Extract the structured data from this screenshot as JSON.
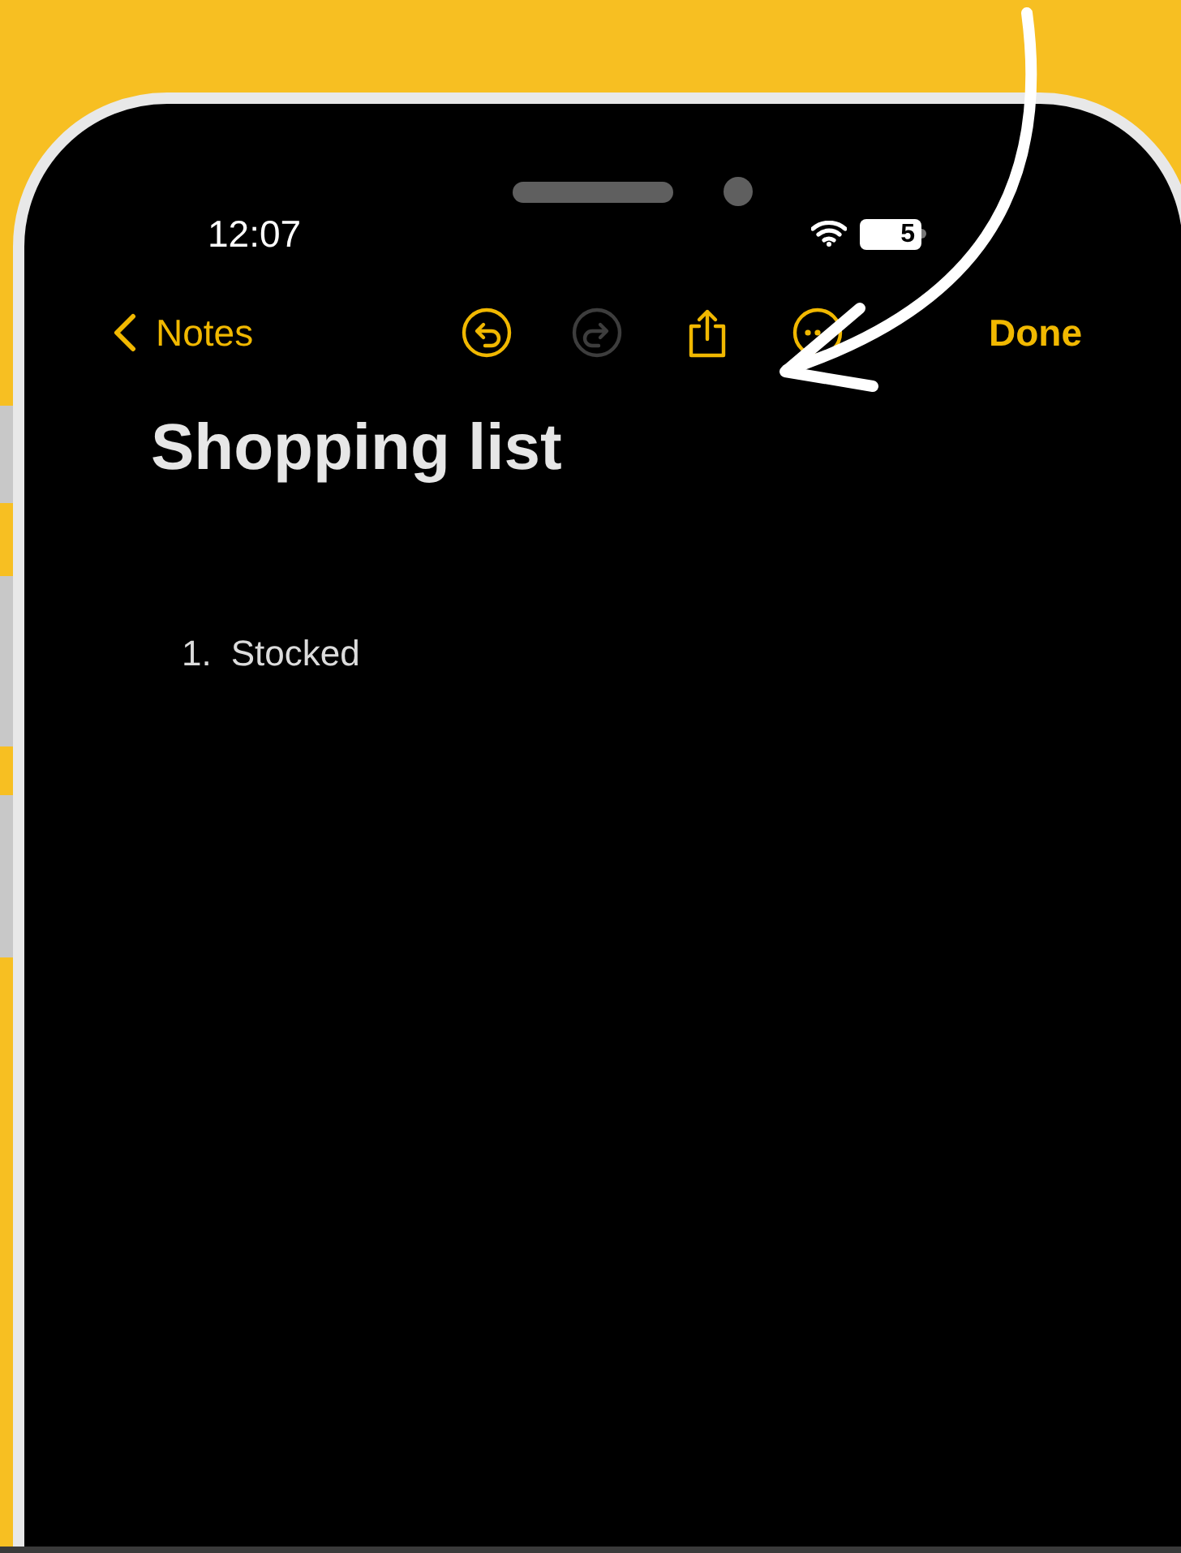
{
  "status_bar": {
    "time": "12:07",
    "battery": "5"
  },
  "nav_bar": {
    "back_label": "Notes",
    "buttons": [
      {
        "kind": "undo",
        "disabled": false
      },
      {
        "kind": "redo",
        "disabled": true
      },
      {
        "kind": "share",
        "disabled": false
      },
      {
        "kind": "more",
        "disabled": false
      }
    ],
    "done_label": "Done"
  },
  "note": {
    "title": "Shopping list",
    "items": [
      {
        "number": "1.",
        "text": "Stocked"
      }
    ]
  }
}
